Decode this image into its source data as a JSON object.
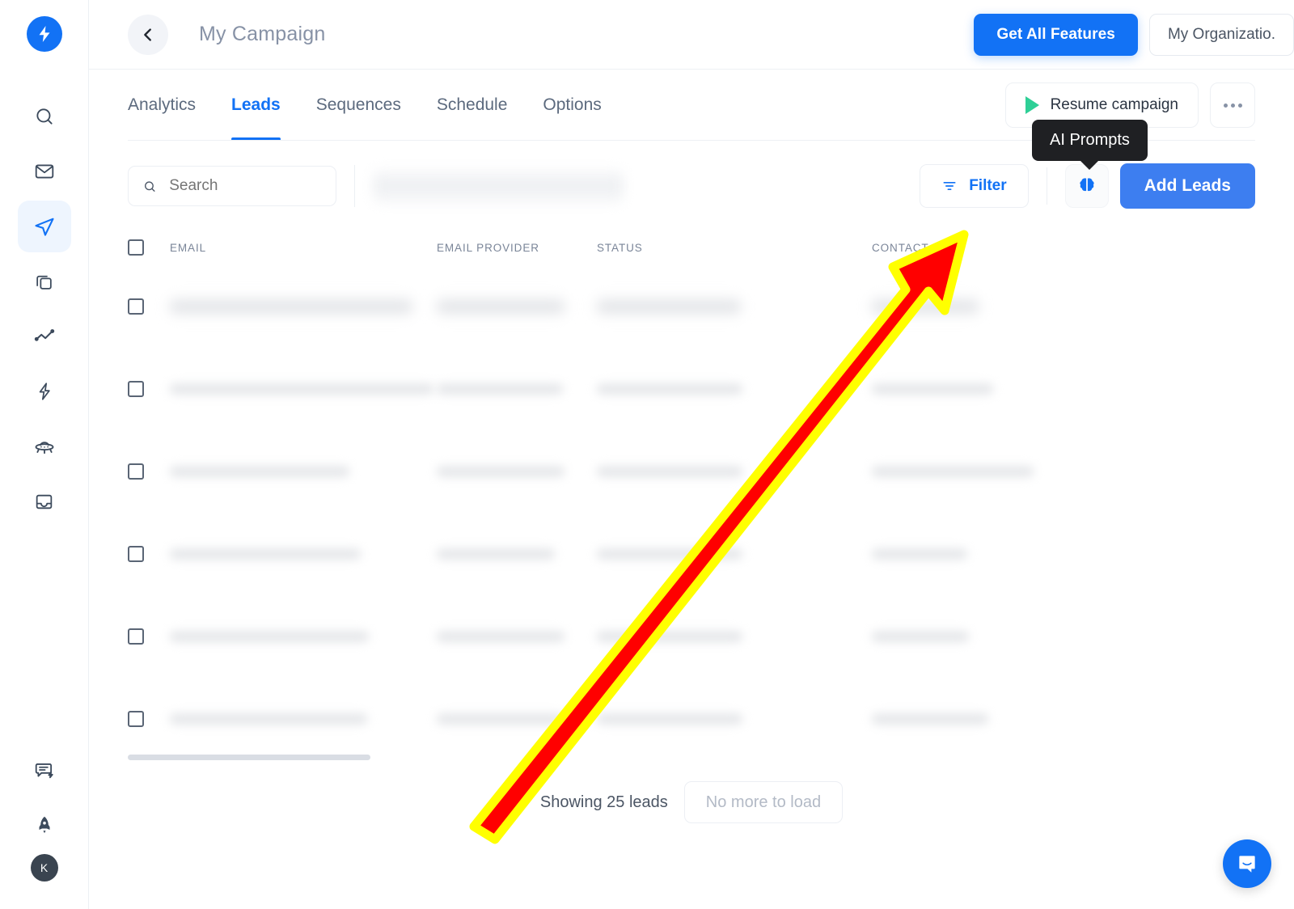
{
  "app": {
    "logo_icon": "lightning-bolt-logo",
    "brand_color": "#1272f5"
  },
  "sidebar": {
    "items": [
      {
        "icon": "search-icon",
        "name": "search",
        "active": false
      },
      {
        "icon": "mail-icon",
        "name": "mailbox",
        "active": false
      },
      {
        "icon": "paper-plane-icon",
        "name": "campaigns",
        "active": true
      },
      {
        "icon": "copy-layers-icon",
        "name": "templates",
        "active": false
      },
      {
        "icon": "line-chart-icon",
        "name": "analytics",
        "active": false
      },
      {
        "icon": "lightning-bolt-icon",
        "name": "automations",
        "active": false
      },
      {
        "icon": "ufo-icon",
        "name": "lead-finder",
        "active": false
      },
      {
        "icon": "inbox-icon",
        "name": "unibox",
        "active": false
      }
    ],
    "bottom_items": [
      {
        "icon": "chat-bolt-icon",
        "name": "feedback"
      },
      {
        "icon": "rocket-icon",
        "name": "whats-new"
      }
    ],
    "avatar_initial": "K"
  },
  "topbar": {
    "back_icon": "chevron-left-icon",
    "title": "My Campaign",
    "get_all_features_label": "Get All Features",
    "organization_label": "My Organizatio."
  },
  "tabs": [
    {
      "label": "Analytics",
      "active": false
    },
    {
      "label": "Leads",
      "active": true
    },
    {
      "label": "Sequences",
      "active": false
    },
    {
      "label": "Schedule",
      "active": false
    },
    {
      "label": "Options",
      "active": false
    }
  ],
  "campaign_actions": {
    "resume_label": "Resume campaign",
    "play_icon": "play-triangle-icon",
    "play_color": "#2ecf96",
    "more_icon": "ellipsis-icon"
  },
  "toolbar": {
    "search_placeholder": "Search",
    "search_value": "",
    "search_icon": "search-icon",
    "filter_label": "Filter",
    "filter_icon": "filter-lines-icon",
    "ai_prompts_icon": "brain-icon",
    "add_leads_label": "Add Leads"
  },
  "tooltip": {
    "text": "AI Prompts"
  },
  "table": {
    "columns": [
      "EMAIL",
      "EMAIL PROVIDER",
      "STATUS",
      "CONTACT"
    ],
    "select_all_checkbox": false,
    "rows": [
      {
        "checked": false,
        "email": "",
        "provider": "",
        "status": "",
        "contact": ""
      },
      {
        "checked": false,
        "email": "",
        "provider": "",
        "status": "",
        "contact": ""
      },
      {
        "checked": false,
        "email": "",
        "provider": "",
        "status": "",
        "contact": ""
      },
      {
        "checked": false,
        "email": "",
        "provider": "",
        "status": "",
        "contact": ""
      },
      {
        "checked": false,
        "email": "",
        "provider": "",
        "status": "",
        "contact": ""
      },
      {
        "checked": false,
        "email": "",
        "provider": "",
        "status": "",
        "contact": ""
      }
    ]
  },
  "footer": {
    "showing_label": "Showing 25 leads",
    "no_more_label": "No more to load"
  },
  "messenger": {
    "icon": "intercom-chat-icon",
    "color": "#1272f5"
  },
  "annotation": {
    "type": "arrow",
    "fill": "#ff0000",
    "stroke": "#ffff00",
    "points_to": "ai-prompts-button"
  }
}
